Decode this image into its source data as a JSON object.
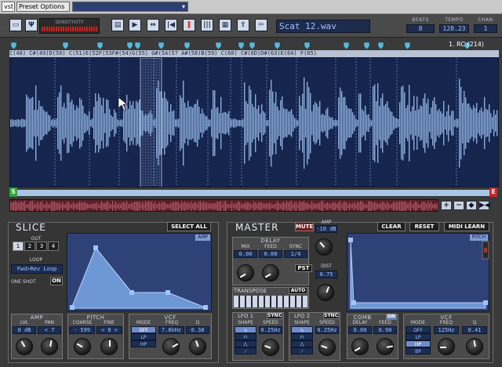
{
  "host": {
    "vst_label": "vst",
    "preset_options": "Preset Options",
    "preset_selected": ""
  },
  "toolbar": {
    "sensitivity_label": "SENSITIVITY",
    "filename": "Scat 12.wav",
    "beats_label": "BEATS",
    "beats_value": "8",
    "tempo_label": "TEMPO",
    "tempo_value": "128.23",
    "chan_label": "CHAN",
    "chan_value": "1",
    "icons": [
      "folder-icon",
      "antenna-icon",
      "page-icon",
      "play-icon",
      "split-icon",
      "detect-icon",
      "slice-marker-icon",
      "barcode-icon",
      "grid-icon",
      "export-icon",
      "midi-icon",
      "scissors-icon"
    ]
  },
  "waveform": {
    "notes": "C(48)  C#(49)D(50)     C(51)E(52F(53F#(54)G(55)  G#(5A(57 A#(58)B(59) C(60)    C#(6D)D#(63)E(64)        F(65)",
    "rc_label": "1. RC (214)",
    "start_marker": "S",
    "end_marker": "E",
    "zoom_buttons": [
      "+",
      "−",
      "◆",
      "▶◀"
    ]
  },
  "slice": {
    "title": "SLICE",
    "select_all": "SELECT ALL",
    "out_label": "OUT",
    "out_buttons": [
      "1",
      "2",
      "3",
      "4"
    ],
    "out_selected": "1",
    "loop_label": "LOOP",
    "loop_value": "Fwd>Rev Loop",
    "oneshot_label": "ONE SHOT",
    "oneshot_value": "ON",
    "env_label": "AMP",
    "amp": {
      "title": "AMP",
      "lvl_label": "LVL",
      "lvl_value": "0 dB",
      "pan_label": "PAN",
      "pan_value": "< 7"
    },
    "pitch": {
      "title": "PITCH",
      "coarse_label": "COARSE",
      "coarse_value": "- 599",
      "fine_label": "FINE",
      "fine_value": "< 0 >"
    },
    "vcf": {
      "title": "VCF",
      "mode_label": "MODE",
      "modes": [
        "OFF",
        "LP",
        "HP"
      ],
      "mode_selected": "OFF",
      "freq_label": "FREQ",
      "freq_value": "7.8kHz",
      "q_label": "Q",
      "q_value": "0.38"
    }
  },
  "master": {
    "title": "MASTER",
    "mute": "MUTE",
    "amp_label": "AMP",
    "amp_value": "-10 dB",
    "clear": "CLEAR",
    "reset": "RESET",
    "midi_learn": "MIDI LEARN",
    "delay": {
      "title": "DELAY",
      "mix_label": "MIX",
      "mix_value": "0.00",
      "feed_label": "FEED",
      "feed_value": "0.00",
      "sync_label": "SYNC",
      "sync_value": "1/4"
    },
    "pst": "PST",
    "dist_label": "DIST",
    "dist_value": "0.75",
    "transpose_label": "TRANSPOSE",
    "auto": "AUTO",
    "lfo1": {
      "title": "LFO 1",
      "sync": "SYNC",
      "shape_label": "SHAPE",
      "speed_label": "SPEED",
      "speed_value": "0.25Hz"
    },
    "lfo2": {
      "title": "LFO 2",
      "sync": "SYNC",
      "shape_label": "SHAPE",
      "speed_label": "SPEED",
      "speed_value": "0.25Hz"
    },
    "comb": {
      "title": "COMB",
      "on": "ON",
      "delay_label": "DELAY",
      "delay_value": "0.00",
      "feed_label": "FEED",
      "feed_value": "0.90"
    },
    "vcf": {
      "title": "VCF",
      "mode_label": "MODE",
      "modes": [
        "OFF",
        "LP",
        "HP",
        "BP"
      ],
      "mode_selected": "HP",
      "freq_label": "FREQ",
      "freq_value": "125Hz",
      "q_label": "Q",
      "q_value": "0.41"
    },
    "env_label": "PITCH"
  }
}
